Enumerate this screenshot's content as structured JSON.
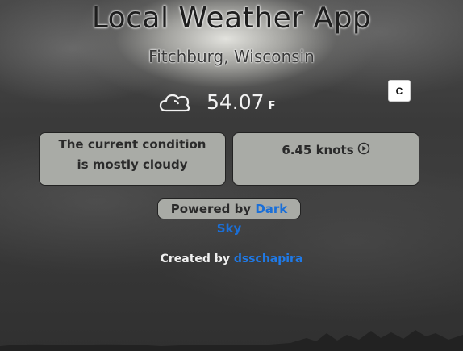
{
  "header": {
    "app_title": "Local Weather App",
    "location": "Fitchburg, Wisconsin"
  },
  "current": {
    "icon": "cloud-icon",
    "temperature": "54.07",
    "unit": "F",
    "toggle_label": "C"
  },
  "condition_card": {
    "text": "The current condition is mostly cloudy"
  },
  "wind_card": {
    "speed": "6.45 knots",
    "direction_icon": "play-circle-icon"
  },
  "powered_by": {
    "prefix": "Powered by",
    "link_text": "Dark Sky"
  },
  "credit": {
    "prefix": "Created by",
    "link_text": "dsschapira"
  },
  "colors": {
    "link": "#1a6fd8",
    "card_bg": "#a9aba6",
    "toggle_bg": "#ffffff"
  }
}
